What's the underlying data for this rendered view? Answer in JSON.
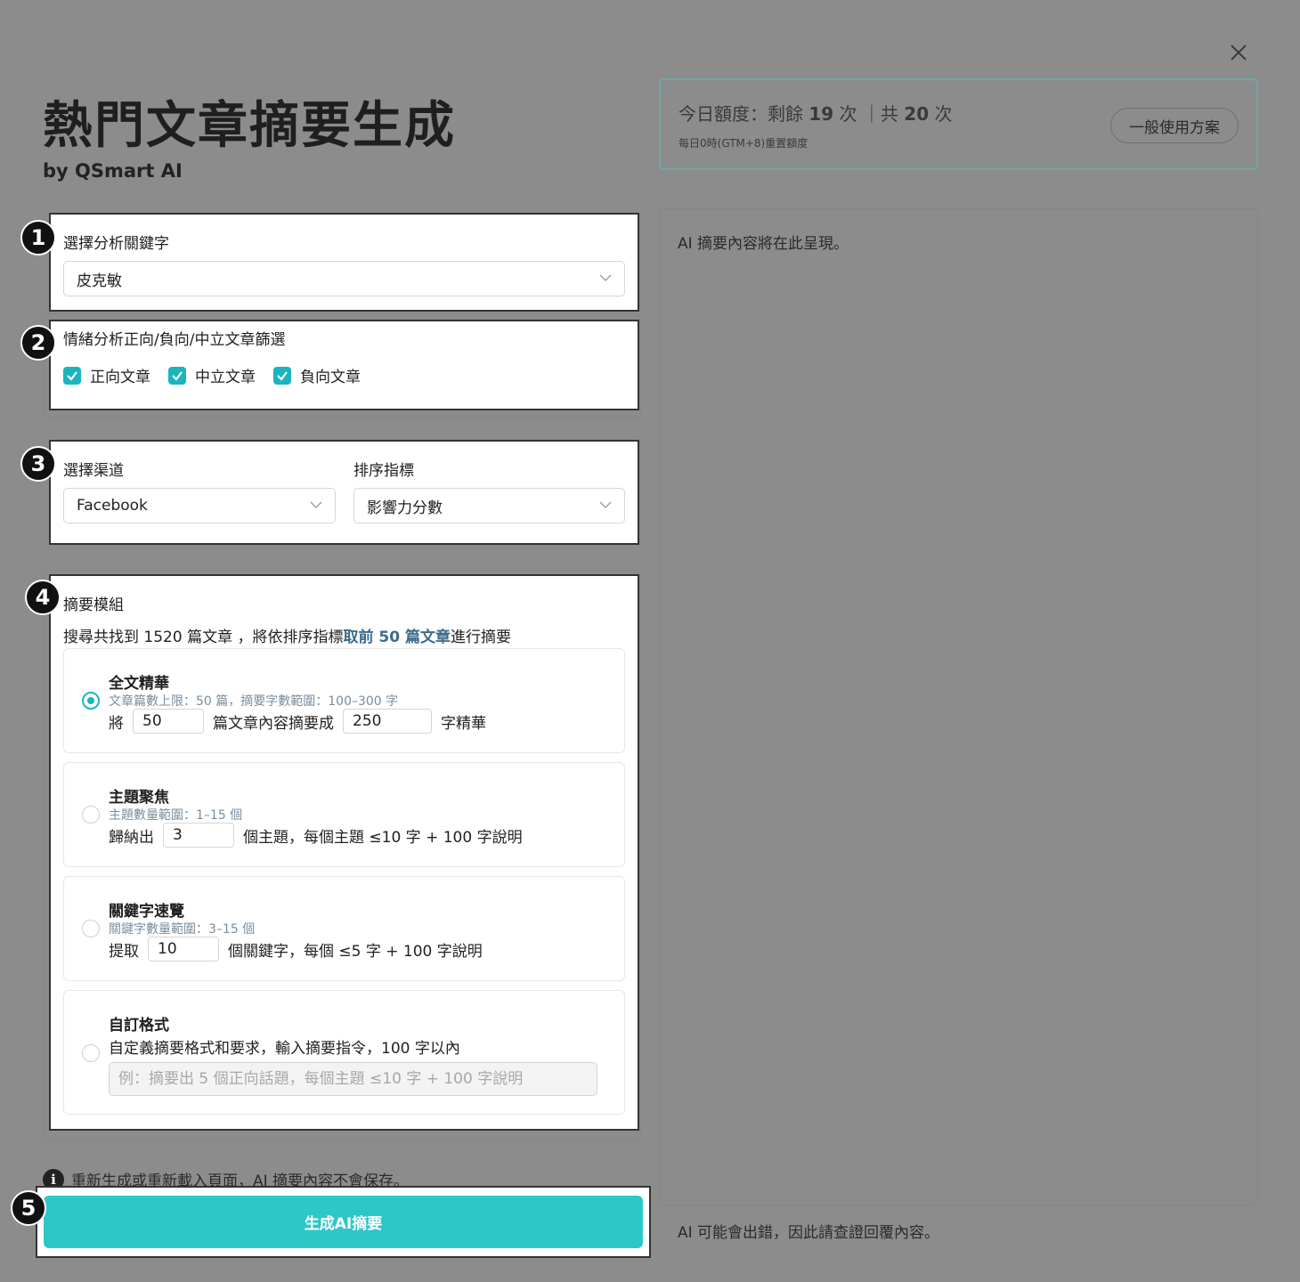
{
  "header": {
    "title": "熱門文章摘要生成",
    "subtitle": "by QSmart AI"
  },
  "quota": {
    "prefix": "今日額度：剩餘 ",
    "remaining": "19",
    "mid": " 次 ｜共 ",
    "total": "20",
    "suffix": " 次",
    "note": "每日0時(GTM+8)重置額度",
    "plan_button": "一般使用方案"
  },
  "steps": {
    "keyword": {
      "badge": "1",
      "label": "選擇分析關鍵字",
      "selected": "皮克敏"
    },
    "sentiment": {
      "badge": "2",
      "label": "情緒分析正向/負向/中立文章篩選",
      "options": [
        {
          "label": "正向文章",
          "checked": true
        },
        {
          "label": "中立文章",
          "checked": true
        },
        {
          "label": "負向文章",
          "checked": true
        }
      ]
    },
    "channel": {
      "badge": "3",
      "channel_label": "選擇渠道",
      "channel_value": "Facebook",
      "sort_label": "排序指標",
      "sort_value": "影響力分數"
    },
    "summary": {
      "badge": "4",
      "label": "摘要模組",
      "found_prefix": "搜尋共找到 1520 篇文章 ，將依排序指標",
      "found_highlight": "取前 50 篇文章",
      "found_suffix": "進行摘要",
      "options": [
        {
          "title": "全文精華",
          "hint": "文章篇數上限：50 篇，摘要字數範圍：100–300 字",
          "pre": "將",
          "value1": "50",
          "mid": "篇文章內容摘要成",
          "value2": "250",
          "post": "字精華",
          "selected": true
        },
        {
          "title": "主題聚焦",
          "hint": "主題數量範圍：1–15 個",
          "pre": "歸納出",
          "value1": "3",
          "post": "個主題，每個主題 ≤10 字 + 100 字說明",
          "selected": false
        },
        {
          "title": "關鍵字速覽",
          "hint": "關鍵字數量範圍：3–15 個",
          "pre": "提取",
          "value1": "10",
          "post": "個關鍵字，每個 ≤5 字 + 100 字說明",
          "selected": false
        },
        {
          "title": "自訂格式",
          "desc": "自定義摘要格式和要求，輸入摘要指令，100 字以內",
          "placeholder": "例：摘要出 5 個正向話題，每個主題 ≤10 字 + 100 字說明",
          "selected": false
        }
      ]
    },
    "generate": {
      "badge": "5",
      "button": "生成AI摘要"
    }
  },
  "info_note": "重新生成或重新載入頁面，AI 摘要內容不會保存。",
  "result": {
    "placeholder": "AI 摘要內容將在此呈現。",
    "disclaimer": "AI 可能會出錯，因此請查證回覆內容。"
  }
}
